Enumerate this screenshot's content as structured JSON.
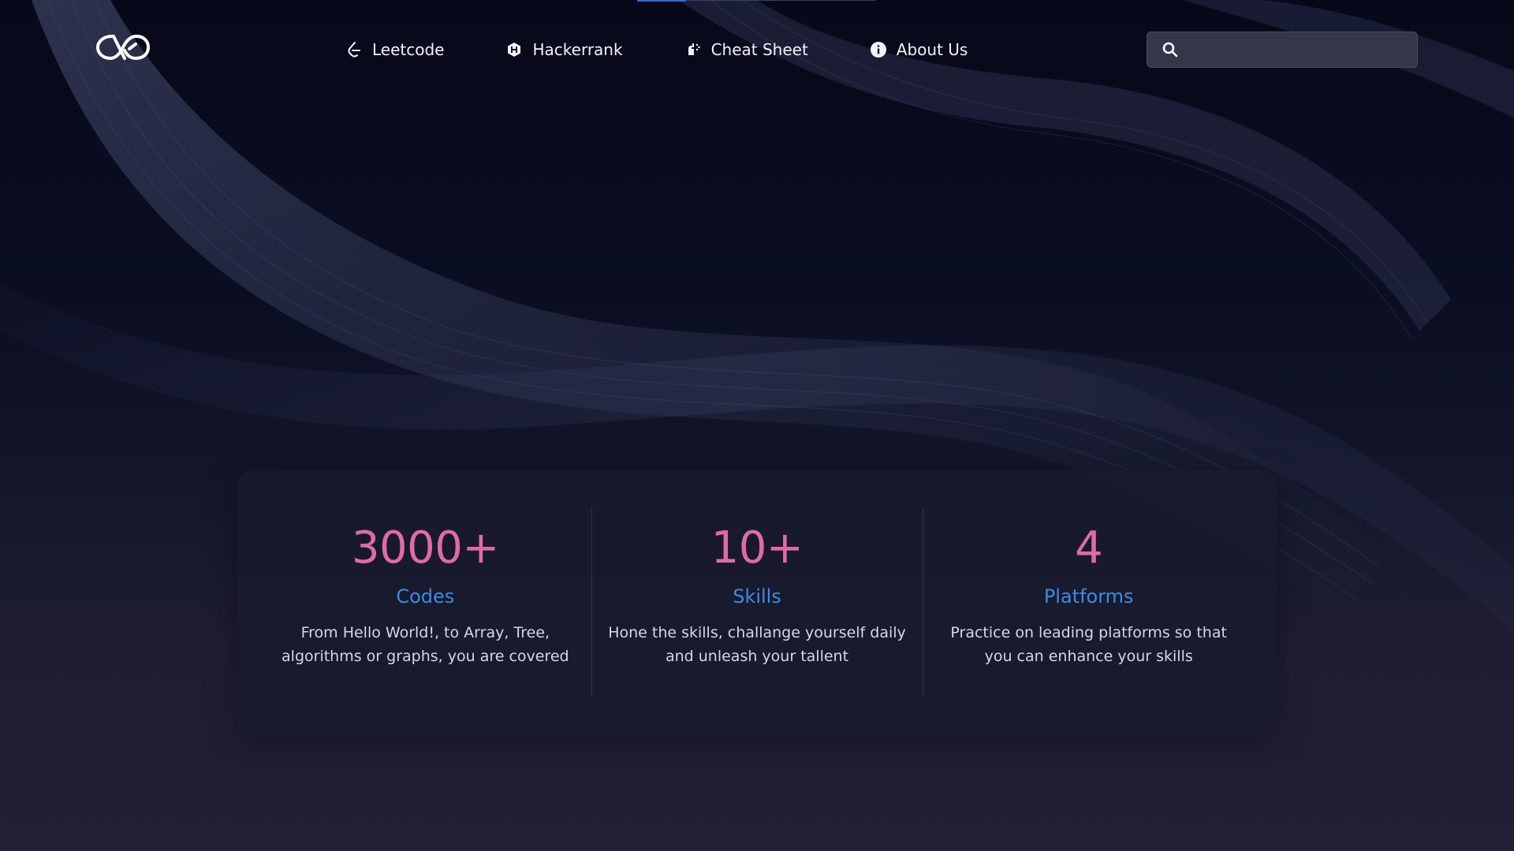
{
  "header": {
    "nav": [
      {
        "label": "Leetcode",
        "icon": "leetcode-icon"
      },
      {
        "label": "Hackerrank",
        "icon": "hackerrank-icon"
      },
      {
        "label": "Cheat Sheet",
        "icon": "cheat-sheet-icon"
      },
      {
        "label": "About Us",
        "icon": "info-icon"
      }
    ],
    "search": {
      "placeholder": "",
      "value": ""
    }
  },
  "stats": [
    {
      "value": "3000+",
      "title": "Codes",
      "description": "From Hello World!, to Array, Tree, algorithms or graphs, you are covered"
    },
    {
      "value": "10+",
      "title": "Skills",
      "description": "Hone the skills, challange yourself daily and unleash your tallent"
    },
    {
      "value": "4",
      "title": "Platforms",
      "description": "Practice on leading platforms so that you can enhance your skills"
    }
  ],
  "colors": {
    "stat_value": "#e06aa8",
    "stat_title": "#3d8ae8",
    "background": "#0b0e22",
    "panel": "#181b2d",
    "accent": "#2f6fd4"
  }
}
